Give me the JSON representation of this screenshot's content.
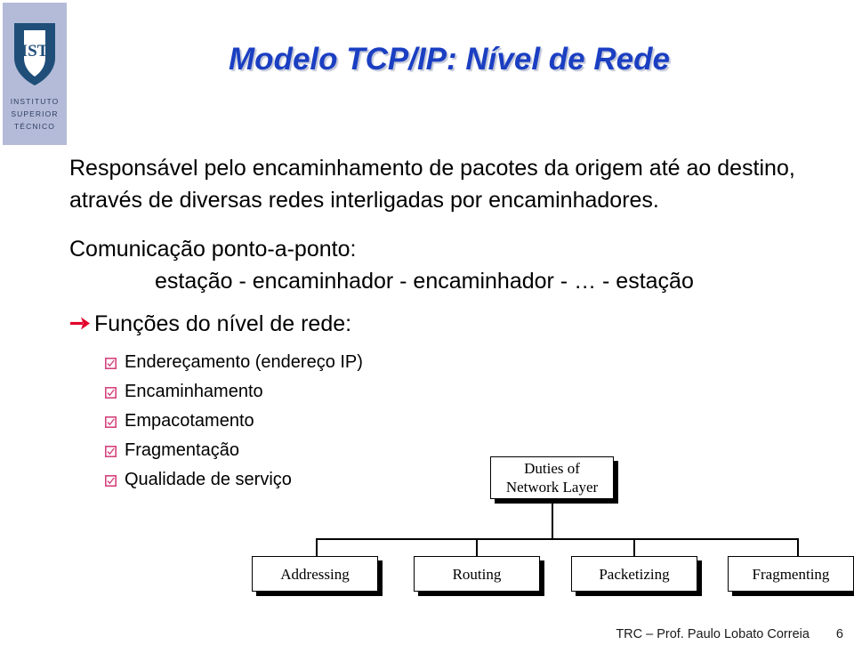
{
  "logo": {
    "institution_line1": "INSTITUTO",
    "institution_line2": "SUPERIOR",
    "institution_line3": "TÉCNICO",
    "monogram": "IST",
    "band_color": "#b4bbd8",
    "shield_color": "#1f4e79"
  },
  "title": {
    "text": "Modelo TCP/IP: Nível de Rede",
    "color": "#1b3fc2",
    "shadow_color": "#c3c8d8"
  },
  "body": {
    "intro": "Responsável pelo encaminhamento de pacotes da origem até ao destino, através de diversas redes interligadas por encaminhadores.",
    "communication_heading": "Comunicação ponto-a-ponto:",
    "communication_chain": "estação - encaminhador - encaminhador - … - estação"
  },
  "functions": {
    "heading": "Funções do nível de rede:",
    "arrow_color": "#e3002b",
    "bullet_color": "#d6447c",
    "items": [
      "Endereçamento (endereço IP)",
      "Encaminhamento",
      "Empacotamento",
      "Fragmentação",
      "Qualidade de serviço"
    ]
  },
  "diagram": {
    "root": "Duties of\nNetwork Layer",
    "root_line1": "Duties of",
    "root_line2": "Network Layer",
    "children": [
      "Addressing",
      "Routing",
      "Packetizing",
      "Fragmenting"
    ]
  },
  "footer": {
    "credit": "TRC – Prof. Paulo Lobato Correia",
    "page_number": "6"
  }
}
